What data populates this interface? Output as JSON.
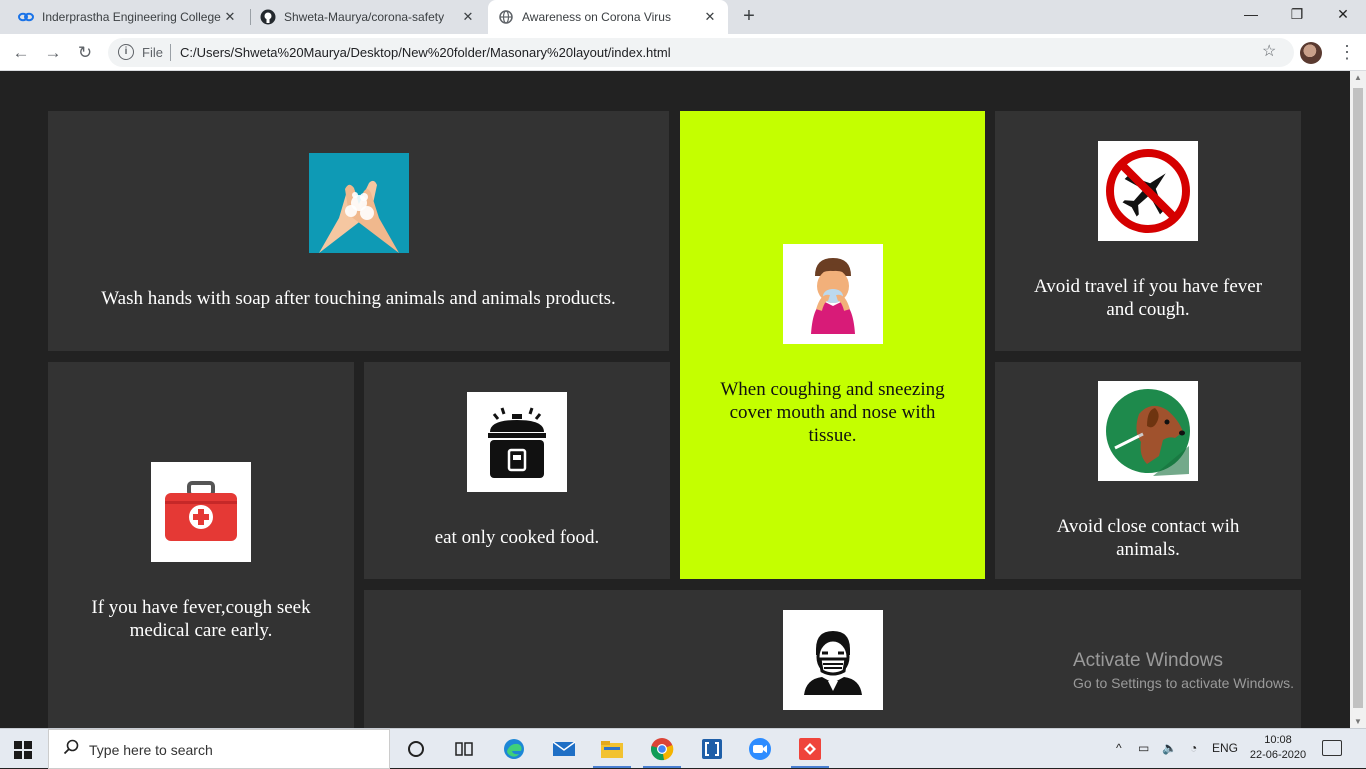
{
  "browser": {
    "tabs": [
      {
        "title": "Inderprastha Engineering College",
        "icon": "link-icon"
      },
      {
        "title": "Shweta-Maurya/corona-safety",
        "icon": "github-icon"
      },
      {
        "title": "Awareness on Corona Virus",
        "icon": "globe-icon"
      }
    ],
    "address": {
      "scheme_label": "File",
      "url": "C:/Users/Shweta%20Maurya/Desktop/New%20folder/Masonary%20layout/index.html"
    }
  },
  "cards": [
    {
      "text": "Wash hands with soap after touching animals and animals products.",
      "icon": "handwash-icon"
    },
    {
      "text": "When coughing and sneezing cover mouth and nose with tissue.",
      "icon": "cough-icon",
      "accent": "#c4ff00"
    },
    {
      "text": "Avoid travel if you have fever and cough.",
      "icon": "no-travel-icon"
    },
    {
      "text": "If you have fever,cough seek medical care early.",
      "icon": "first-aid-icon"
    },
    {
      "text": "eat only cooked food.",
      "icon": "cooker-icon"
    },
    {
      "text": "Avoid close contact wih animals.",
      "icon": "dog-icon"
    },
    {
      "text": "",
      "icon": "mask-person-icon"
    }
  ],
  "watermark": {
    "line1": "Activate Windows",
    "line2": "Go to Settings to activate Windows."
  },
  "taskbar": {
    "search_placeholder": "Type here to search",
    "language": "ENG",
    "time": "10:08",
    "date": "22-06-2020"
  },
  "colors": {
    "page_bg": "#222222",
    "card_bg": "#333333",
    "accent_card": "#c4ff00"
  }
}
